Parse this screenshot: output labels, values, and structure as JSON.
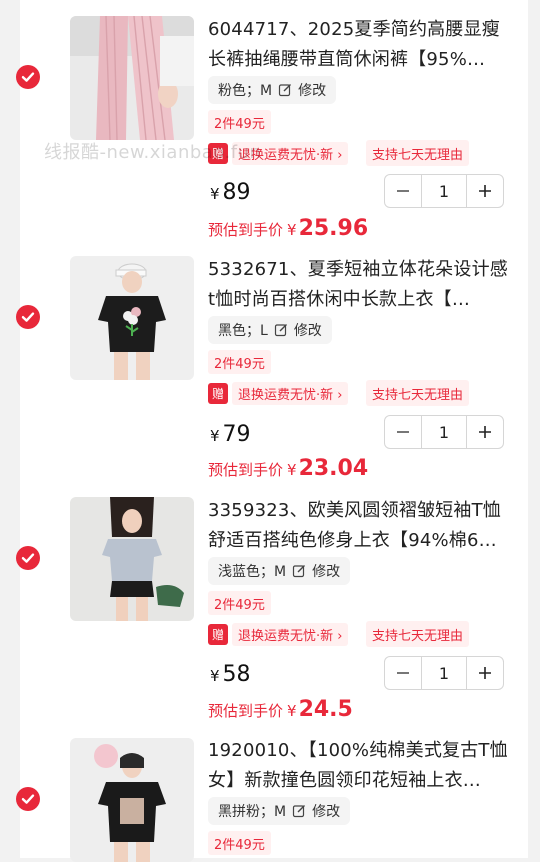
{
  "watermark": "线报酷-new.xianbao.fun",
  "accent_color": "#e8283a",
  "items": [
    {
      "title": "6044717、2025夏季简约高腰显瘦长裤抽绳腰带直筒休闲裤【95%…",
      "sku": "粉色；M",
      "edit_label": "修改",
      "promo": "2件49元",
      "gift_badge": "赠",
      "gift_text": "退换运费无忧·新 ›",
      "return_tag": "支持七天无理由",
      "currency": "¥",
      "price": "89",
      "qty": "1",
      "est_label": "预估到手价",
      "est_price": "25.96",
      "checked": true,
      "image": "pink-pants-photo"
    },
    {
      "title": "5332671、夏季短袖立体花朵设计感t恤时尚百搭休闲中长款上衣【…",
      "sku": "黑色；L",
      "edit_label": "修改",
      "promo": "2件49元",
      "gift_badge": "赠",
      "gift_text": "退换运费无忧·新 ›",
      "return_tag": "支持七天无理由",
      "currency": "¥",
      "price": "79",
      "qty": "1",
      "est_label": "预估到手价",
      "est_price": "23.04",
      "checked": true,
      "image": "black-flower-tshirt-photo"
    },
    {
      "title": "3359323、欧美风圆领褶皱短袖T恤舒适百搭纯色修身上衣【94%棉6…",
      "sku": "浅蓝色；M",
      "edit_label": "修改",
      "promo": "2件49元",
      "gift_badge": "赠",
      "gift_text": "退换运费无忧·新 ›",
      "return_tag": "支持七天无理由",
      "currency": "¥",
      "price": "58",
      "qty": "1",
      "est_label": "预估到手价",
      "est_price": "24.5",
      "checked": true,
      "image": "light-blue-tshirt-photo"
    },
    {
      "title": "1920010、【100%纯棉美式复古T恤女】新款撞色圆领印花短袖上衣…",
      "sku": "黑拼粉；M",
      "edit_label": "修改",
      "promo": "2件49元",
      "checked": true,
      "image": "black-print-tshirt-photo"
    }
  ]
}
